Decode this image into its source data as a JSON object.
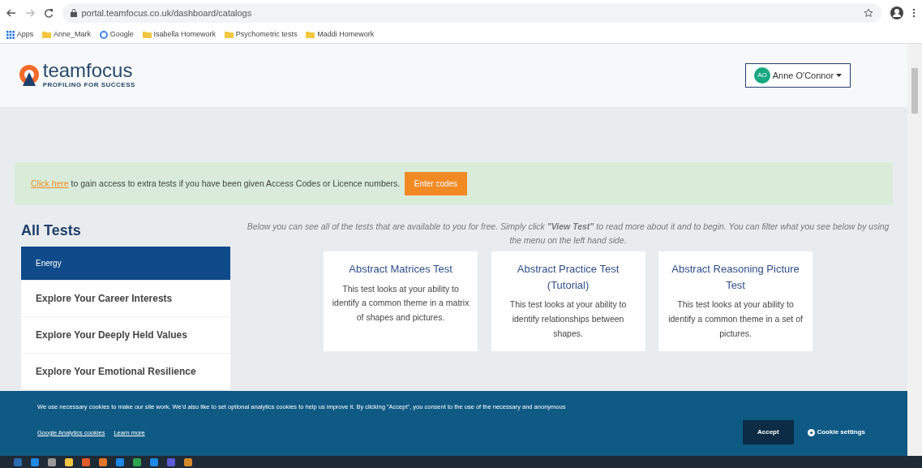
{
  "browser": {
    "url": "portal.teamfocus.co.uk/dashboard/catalogs",
    "bookmarks": [
      {
        "label": "Apps",
        "kind": "apps"
      },
      {
        "label": "Anne_Mark",
        "kind": "folder"
      },
      {
        "label": "Google",
        "kind": "google"
      },
      {
        "label": "Isabella Homework",
        "kind": "folder"
      },
      {
        "label": "Psychometric tests",
        "kind": "folder"
      },
      {
        "label": "Maddi Homework",
        "kind": "folder"
      }
    ]
  },
  "header": {
    "logo": "teamfocus",
    "tagline": "PROFILING FOR SUCCESS",
    "user": {
      "initials": "AO",
      "name": "Anne O'Connor"
    }
  },
  "alert": {
    "link": "Click here",
    "text": "to gain access to extra tests if you have been given Access Codes or Licence numbers.",
    "button": "Enter codes"
  },
  "sidebar": {
    "title": "All Tests",
    "items": [
      {
        "label": "Energy",
        "selected": true
      },
      {
        "label": "Explore Your Career Interests",
        "selected": false
      },
      {
        "label": "Explore Your Deeply Held Values",
        "selected": false
      },
      {
        "label": "Explore Your Emotional Resilience",
        "selected": false
      }
    ]
  },
  "intro": "Below you can see all of the tests that are available to you for free. Simply click **\"View Test\"** to read more about it and to begin. You can filter what you see below by using the menu on the left hand side.",
  "tests": [
    {
      "title": "Abstract Matrices Test",
      "description": "This test looks at your ability to identify a common theme in a matrix of shapes and pictures."
    },
    {
      "title": "Abstract Practice Test (Tutorial)",
      "description": "This test looks at your ability to identify relationships between shapes."
    },
    {
      "title": "Abstract Reasoning Picture Test",
      "description": "This test looks at your ability to identify a common theme in a set of pictures."
    }
  ],
  "cookie_banner": {
    "text": "We use necessary cookies to make our site work. We'd also like to set optional analytics cookies to help us improve it. By clicking \"Accept\", you consent to the use of the necessary and anonymous",
    "links": [
      "Google Analytics cookies",
      "Learn more"
    ],
    "accept": "Accept",
    "settings": "Cookie settings"
  }
}
